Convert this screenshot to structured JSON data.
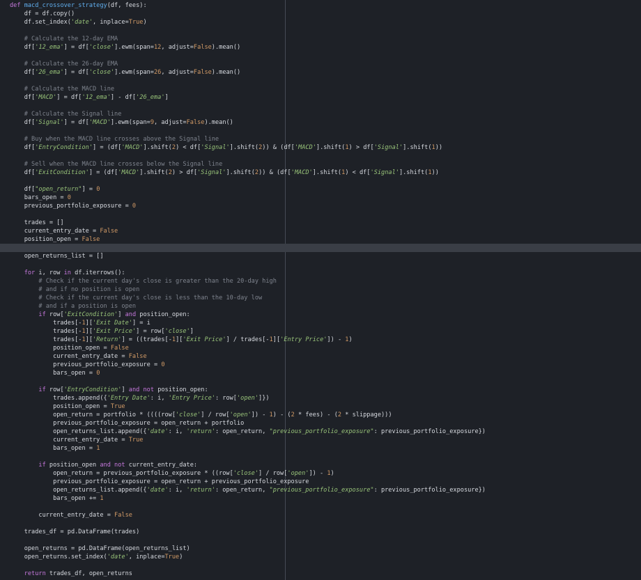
{
  "editor": {
    "language": "python",
    "highlight_line": 29,
    "colors": {
      "background": "#1e2127",
      "current_line": "#3a3e46",
      "ruler": "#464b55",
      "keyword": "#c678dd",
      "function_name": "#61afef",
      "string": "#98c379",
      "comment": "#7f848e",
      "number": "#d19a66",
      "text": "#d7dae0"
    },
    "lines": [
      [
        [
          "kw",
          "def "
        ],
        [
          "fn",
          "macd_crossover_strategy"
        ],
        [
          "t",
          "(df, fees):"
        ]
      ],
      [
        [
          "t",
          "    df = df.copy()"
        ]
      ],
      [
        [
          "t",
          "    df.set_index("
        ],
        [
          "s",
          "'date'"
        ],
        [
          "t",
          ", inplace="
        ],
        [
          "c",
          "True"
        ],
        [
          "t",
          ")"
        ]
      ],
      [
        [
          "t",
          ""
        ]
      ],
      [
        [
          "cm",
          "    # Calculate the 12-day EMA"
        ]
      ],
      [
        [
          "t",
          "    df["
        ],
        [
          "s",
          "'12_ema'"
        ],
        [
          "t",
          "] = df["
        ],
        [
          "s",
          "'close'"
        ],
        [
          "t",
          "].ewm(span="
        ],
        [
          "n",
          "12"
        ],
        [
          "t",
          ", adjust="
        ],
        [
          "c",
          "False"
        ],
        [
          "t",
          ").mean()"
        ]
      ],
      [
        [
          "t",
          ""
        ]
      ],
      [
        [
          "cm",
          "    # Calculate the 26-day EMA"
        ]
      ],
      [
        [
          "t",
          "    df["
        ],
        [
          "s",
          "'26_ema'"
        ],
        [
          "t",
          "] = df["
        ],
        [
          "s",
          "'close'"
        ],
        [
          "t",
          "].ewm(span="
        ],
        [
          "n",
          "26"
        ],
        [
          "t",
          ", adjust="
        ],
        [
          "c",
          "False"
        ],
        [
          "t",
          ").mean()"
        ]
      ],
      [
        [
          "t",
          ""
        ]
      ],
      [
        [
          "cm",
          "    # Calculate the MACD line"
        ]
      ],
      [
        [
          "t",
          "    df["
        ],
        [
          "s",
          "'MACD'"
        ],
        [
          "t",
          "] = df["
        ],
        [
          "s",
          "'12_ema'"
        ],
        [
          "t",
          "] - df["
        ],
        [
          "s",
          "'26_ema'"
        ],
        [
          "t",
          "]"
        ]
      ],
      [
        [
          "t",
          ""
        ]
      ],
      [
        [
          "cm",
          "    # Calculate the Signal line"
        ]
      ],
      [
        [
          "t",
          "    df["
        ],
        [
          "s",
          "'Signal'"
        ],
        [
          "t",
          "] = df["
        ],
        [
          "s",
          "'MACD'"
        ],
        [
          "t",
          "].ewm(span="
        ],
        [
          "n",
          "9"
        ],
        [
          "t",
          ", adjust="
        ],
        [
          "c",
          "False"
        ],
        [
          "t",
          ").mean()"
        ]
      ],
      [
        [
          "t",
          ""
        ]
      ],
      [
        [
          "cm",
          "    # Buy when the MACD line crosses above the Signal line"
        ]
      ],
      [
        [
          "t",
          "    df["
        ],
        [
          "s",
          "'EntryCondition'"
        ],
        [
          "t",
          "] = (df["
        ],
        [
          "s",
          "'MACD'"
        ],
        [
          "t",
          "].shift("
        ],
        [
          "n",
          "2"
        ],
        [
          "t",
          ") < df["
        ],
        [
          "s",
          "'Signal'"
        ],
        [
          "t",
          "].shift("
        ],
        [
          "n",
          "2"
        ],
        [
          "t",
          ")) & (df["
        ],
        [
          "s",
          "'MACD'"
        ],
        [
          "t",
          "].shift("
        ],
        [
          "n",
          "1"
        ],
        [
          "t",
          ") > df["
        ],
        [
          "s",
          "'Signal'"
        ],
        [
          "t",
          "].shift("
        ],
        [
          "n",
          "1"
        ],
        [
          "t",
          "))"
        ]
      ],
      [
        [
          "t",
          ""
        ]
      ],
      [
        [
          "cm",
          "    # Sell when the MACD line crosses below the Signal line"
        ]
      ],
      [
        [
          "t",
          "    df["
        ],
        [
          "s",
          "'ExitCondition'"
        ],
        [
          "t",
          "] = (df["
        ],
        [
          "s",
          "'MACD'"
        ],
        [
          "t",
          "].shift("
        ],
        [
          "n",
          "2"
        ],
        [
          "t",
          ") > df["
        ],
        [
          "s",
          "'Signal'"
        ],
        [
          "t",
          "].shift("
        ],
        [
          "n",
          "2"
        ],
        [
          "t",
          ")) & (df["
        ],
        [
          "s",
          "'MACD'"
        ],
        [
          "t",
          "].shift("
        ],
        [
          "n",
          "1"
        ],
        [
          "t",
          ") < df["
        ],
        [
          "s",
          "'Signal'"
        ],
        [
          "t",
          "].shift("
        ],
        [
          "n",
          "1"
        ],
        [
          "t",
          "))"
        ]
      ],
      [
        [
          "t",
          ""
        ]
      ],
      [
        [
          "t",
          "    df["
        ],
        [
          "s",
          "\"open_return\""
        ],
        [
          "t",
          "] = "
        ],
        [
          "n",
          "0"
        ]
      ],
      [
        [
          "t",
          "    bars_open = "
        ],
        [
          "n",
          "0"
        ]
      ],
      [
        [
          "t",
          "    previous_portfolio_exposure = "
        ],
        [
          "n",
          "0"
        ]
      ],
      [
        [
          "t",
          ""
        ]
      ],
      [
        [
          "t",
          "    trades = []"
        ]
      ],
      [
        [
          "t",
          "    current_entry_date = "
        ],
        [
          "c",
          "False"
        ]
      ],
      [
        [
          "t",
          "    position_open = "
        ],
        [
          "c",
          "False"
        ]
      ],
      [
        [
          "t",
          ""
        ]
      ],
      [
        [
          "t",
          "    open_returns_list = []"
        ]
      ],
      [
        [
          "t",
          ""
        ]
      ],
      [
        [
          "kw",
          "    for "
        ],
        [
          "t",
          "i, row "
        ],
        [
          "kw",
          "in "
        ],
        [
          "t",
          "df.iterrows():"
        ]
      ],
      [
        [
          "cm",
          "        # Check if the current day's close is greater than the 20-day high"
        ]
      ],
      [
        [
          "cm",
          "        # and if no position is open"
        ]
      ],
      [
        [
          "cm",
          "        # Check if the current day's close is less than the 10-day low"
        ]
      ],
      [
        [
          "cm",
          "        # and if a position is open"
        ]
      ],
      [
        [
          "kw",
          "        if "
        ],
        [
          "t",
          "row["
        ],
        [
          "s",
          "'ExitCondition'"
        ],
        [
          "t",
          "] "
        ],
        [
          "kw",
          "and "
        ],
        [
          "t",
          "position_open:"
        ]
      ],
      [
        [
          "t",
          "            trades[-"
        ],
        [
          "n",
          "1"
        ],
        [
          "t",
          "]["
        ],
        [
          "s",
          "'Exit Date'"
        ],
        [
          "t",
          "] = i"
        ]
      ],
      [
        [
          "t",
          "            trades[-"
        ],
        [
          "n",
          "1"
        ],
        [
          "t",
          "]["
        ],
        [
          "s",
          "'Exit Price'"
        ],
        [
          "t",
          "] = row["
        ],
        [
          "s",
          "'close'"
        ],
        [
          "t",
          "]"
        ]
      ],
      [
        [
          "t",
          "            trades[-"
        ],
        [
          "n",
          "1"
        ],
        [
          "t",
          "]["
        ],
        [
          "s",
          "'Return'"
        ],
        [
          "t",
          "] = ((trades[-"
        ],
        [
          "n",
          "1"
        ],
        [
          "t",
          "]["
        ],
        [
          "s",
          "'Exit Price'"
        ],
        [
          "t",
          "] / trades[-"
        ],
        [
          "n",
          "1"
        ],
        [
          "t",
          "]["
        ],
        [
          "s",
          "'Entry Price'"
        ],
        [
          "t",
          "]) - "
        ],
        [
          "n",
          "1"
        ],
        [
          "t",
          ")"
        ]
      ],
      [
        [
          "t",
          "            position_open = "
        ],
        [
          "c",
          "False"
        ]
      ],
      [
        [
          "t",
          "            current_entry_date = "
        ],
        [
          "c",
          "False"
        ]
      ],
      [
        [
          "t",
          "            previous_portfolio_exposure = "
        ],
        [
          "n",
          "0"
        ]
      ],
      [
        [
          "t",
          "            bars_open = "
        ],
        [
          "n",
          "0"
        ]
      ],
      [
        [
          "t",
          ""
        ]
      ],
      [
        [
          "kw",
          "        if "
        ],
        [
          "t",
          "row["
        ],
        [
          "s",
          "'EntryCondition'"
        ],
        [
          "t",
          "] "
        ],
        [
          "kw",
          "and not "
        ],
        [
          "t",
          "position_open:"
        ]
      ],
      [
        [
          "t",
          "            trades.append({"
        ],
        [
          "s",
          "'Entry Date'"
        ],
        [
          "t",
          ": i, "
        ],
        [
          "s",
          "'Entry Price'"
        ],
        [
          "t",
          ": row["
        ],
        [
          "s",
          "'open'"
        ],
        [
          "t",
          "]})"
        ]
      ],
      [
        [
          "t",
          "            position_open = "
        ],
        [
          "c",
          "True"
        ]
      ],
      [
        [
          "t",
          "            open_return = portfolio * ((((row["
        ],
        [
          "s",
          "'close'"
        ],
        [
          "t",
          "] / row["
        ],
        [
          "s",
          "'open'"
        ],
        [
          "t",
          "]) - "
        ],
        [
          "n",
          "1"
        ],
        [
          "t",
          ") - ("
        ],
        [
          "n",
          "2"
        ],
        [
          "t",
          " * fees) - ("
        ],
        [
          "n",
          "2"
        ],
        [
          "t",
          " * slippage)))"
        ]
      ],
      [
        [
          "t",
          "            previous_portfolio_exposure = open_return + portfolio"
        ]
      ],
      [
        [
          "t",
          "            open_returns_list.append({"
        ],
        [
          "s",
          "'date'"
        ],
        [
          "t",
          ": i, "
        ],
        [
          "s",
          "'return'"
        ],
        [
          "t",
          ": open_return, "
        ],
        [
          "s",
          "\"previous_portfolio_exposure\""
        ],
        [
          "t",
          ": previous_portfolio_exposure})"
        ]
      ],
      [
        [
          "t",
          "            current_entry_date = "
        ],
        [
          "c",
          "True"
        ]
      ],
      [
        [
          "t",
          "            bars_open = "
        ],
        [
          "n",
          "1"
        ]
      ],
      [
        [
          "t",
          ""
        ]
      ],
      [
        [
          "kw",
          "        if "
        ],
        [
          "t",
          "position_open "
        ],
        [
          "kw",
          "and not "
        ],
        [
          "t",
          "current_entry_date:"
        ]
      ],
      [
        [
          "t",
          "            open_return = previous_portfolio_exposure * ((row["
        ],
        [
          "s",
          "'close'"
        ],
        [
          "t",
          "] / row["
        ],
        [
          "s",
          "'open'"
        ],
        [
          "t",
          "]) - "
        ],
        [
          "n",
          "1"
        ],
        [
          "t",
          ")"
        ]
      ],
      [
        [
          "t",
          "            previous_portfolio_exposure = open_return + previous_portfolio_exposure"
        ]
      ],
      [
        [
          "t",
          "            open_returns_list.append({"
        ],
        [
          "s",
          "'date'"
        ],
        [
          "t",
          ": i, "
        ],
        [
          "s",
          "'return'"
        ],
        [
          "t",
          ": open_return, "
        ],
        [
          "s",
          "\"previous_portfolio_exposure\""
        ],
        [
          "t",
          ": previous_portfolio_exposure})"
        ]
      ],
      [
        [
          "t",
          "            bars_open += "
        ],
        [
          "n",
          "1"
        ]
      ],
      [
        [
          "t",
          ""
        ]
      ],
      [
        [
          "t",
          "        current_entry_date = "
        ],
        [
          "c",
          "False"
        ]
      ],
      [
        [
          "t",
          ""
        ]
      ],
      [
        [
          "t",
          "    trades_df = pd.DataFrame(trades)"
        ]
      ],
      [
        [
          "t",
          ""
        ]
      ],
      [
        [
          "t",
          "    open_returns = pd.DataFrame(open_returns_list)"
        ]
      ],
      [
        [
          "t",
          "    open_returns.set_index("
        ],
        [
          "s",
          "'date'"
        ],
        [
          "t",
          ", inplace="
        ],
        [
          "c",
          "True"
        ],
        [
          "t",
          ")"
        ]
      ],
      [
        [
          "t",
          ""
        ]
      ],
      [
        [
          "kw",
          "    return "
        ],
        [
          "t",
          "trades_df, open_returns"
        ]
      ]
    ]
  }
}
